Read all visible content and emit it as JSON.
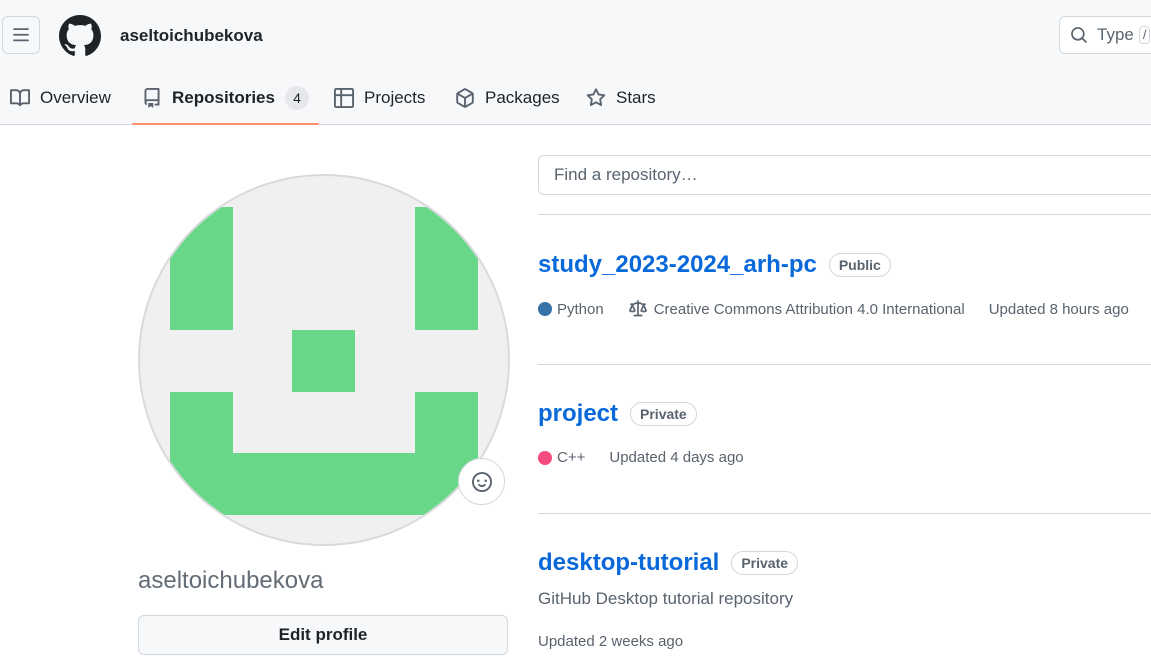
{
  "header": {
    "username": "aseltoichubekova",
    "search_placeholder": "Type",
    "search_key": "/"
  },
  "nav": {
    "tabs": [
      {
        "label": "Overview",
        "icon": "book-icon"
      },
      {
        "label": "Repositories",
        "icon": "repo-icon",
        "count": "4",
        "active": true
      },
      {
        "label": "Projects",
        "icon": "table-icon"
      },
      {
        "label": "Packages",
        "icon": "package-icon"
      },
      {
        "label": "Stars",
        "icon": "star-icon"
      }
    ]
  },
  "profile": {
    "name": "aseltoichubekova",
    "edit_label": "Edit profile",
    "avatar_color": "#68d888"
  },
  "repos": {
    "search_placeholder": "Find a repository…",
    "items": [
      {
        "name": "study_2023-2024_arh-pc",
        "visibility": "Public",
        "language": "Python",
        "language_color": "#3572A5",
        "license": "Creative Commons Attribution 4.0 International",
        "updated": "Updated 8 hours ago"
      },
      {
        "name": "project",
        "visibility": "Private",
        "language": "C++",
        "language_color": "#f34b7d",
        "updated": "Updated 4 days ago"
      },
      {
        "name": "desktop-tutorial",
        "visibility": "Private",
        "description": "GitHub Desktop tutorial repository",
        "updated": "Updated 2 weeks ago"
      }
    ]
  },
  "colors": {
    "link": "#0969da",
    "underline_active": "#fd8c73"
  }
}
